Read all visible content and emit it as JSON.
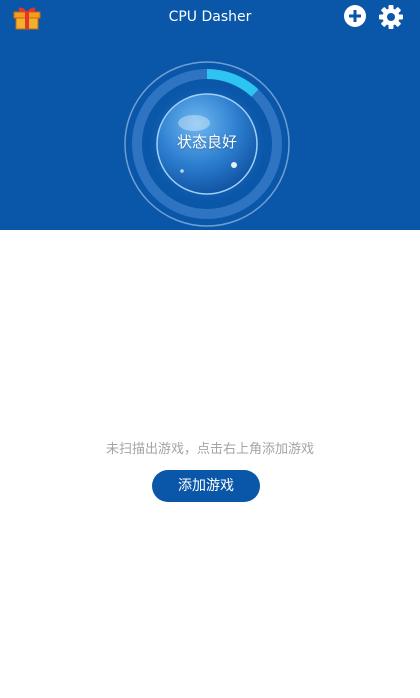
{
  "app": {
    "title": "CPU Dasher"
  },
  "toolbar": {
    "gift_icon": "gift-icon",
    "add_icon": "plus-circle-icon",
    "settings_icon": "gear-icon"
  },
  "status": {
    "label": "状态良好",
    "gauge_fraction": 0.12
  },
  "empty_state": {
    "message": "未扫描出游戏，点击右上角添加游戏",
    "button_label": "添加游戏"
  },
  "colors": {
    "brand_blue": "#0a56a8",
    "gauge_accent": "#2ec4f1",
    "muted_text": "#a4a4a4",
    "background": "#ffffff"
  }
}
